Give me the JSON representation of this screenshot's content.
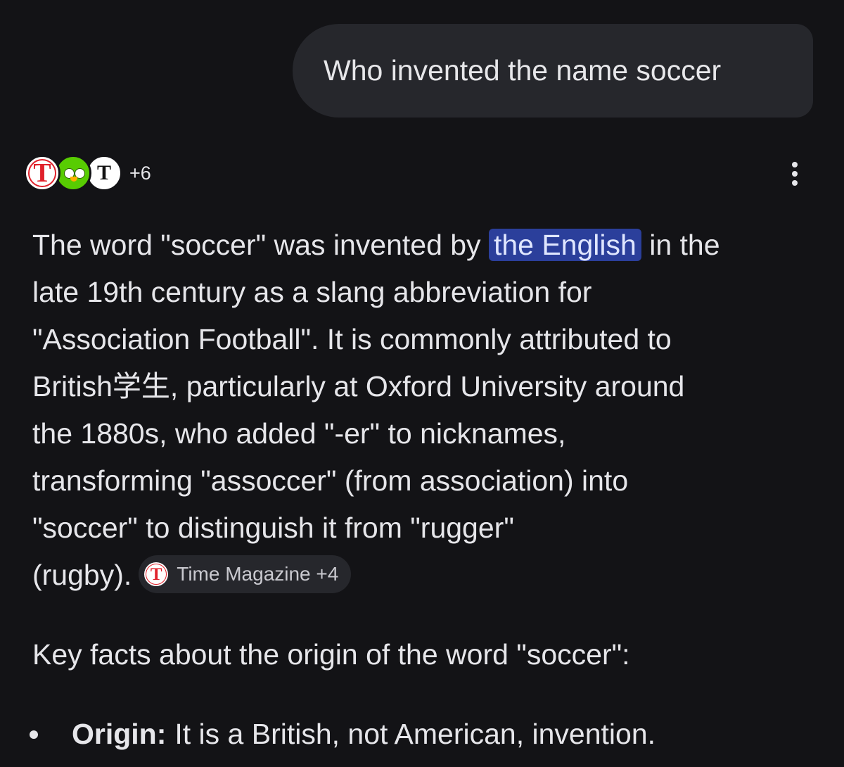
{
  "query": {
    "text": "Who invented the name soccer"
  },
  "sources": {
    "icons": [
      "time-magazine-icon",
      "duolingo-icon",
      "nytimes-icon"
    ],
    "time_glyph": "T",
    "nyt_glyph": "T",
    "more_count": "+6"
  },
  "answer": {
    "line1_pre": "The word \"soccer\" was invented by ",
    "line1_highlight": "the English",
    "line1_post": " in the",
    "line2": "late 19th century as a slang abbreviation for",
    "line3": "\"Association Football\". It is commonly attributed to",
    "line4": "British学生, particularly at Oxford University around",
    "line5": "the 1880s, who added \"-er\" to nicknames,",
    "line6": "transforming \"assoccer\" (from association) into",
    "line7": "\"soccer\" to distinguish it from \"rugger\"",
    "line8": "(rugby).",
    "citation": {
      "glyph": "T",
      "label": "Time Magazine +4"
    }
  },
  "key_facts_heading": "Key facts about the origin of the word \"soccer\":",
  "bullets": [
    {
      "label": "Origin:",
      "text": "It is a British, not American, invention."
    }
  ],
  "colors": {
    "background": "#131316",
    "bubble": "#26272c",
    "highlight": "#2b3f9b",
    "time_red": "#e0212b",
    "duolingo_green": "#58cc02"
  }
}
